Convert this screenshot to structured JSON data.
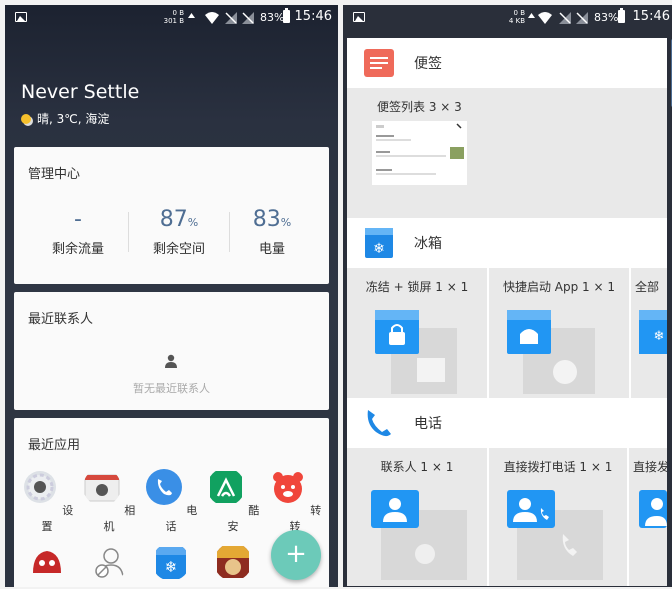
{
  "left": {
    "status": {
      "speed_top": "0 B",
      "speed_bottom": "301 B",
      "battery": "83%",
      "time": "15:46"
    },
    "title": "Never Settle",
    "weather": "晴, 3℃, 海淀",
    "manage": {
      "title": "管理中心",
      "items": [
        {
          "value": "-",
          "unit": "",
          "label": "剩余流量"
        },
        {
          "value": "87",
          "unit": "%",
          "label": "剩余空间"
        },
        {
          "value": "83",
          "unit": "%",
          "label": "电量"
        }
      ]
    },
    "contacts": {
      "title": "最近联系人",
      "empty": "暂无最近联系人"
    },
    "recent": {
      "title": "最近应用",
      "apps": [
        {
          "label": "设置"
        },
        {
          "label": "相机"
        },
        {
          "label": "电话"
        },
        {
          "label": "酷安"
        },
        {
          "label": "转转"
        }
      ]
    },
    "fab": "+"
  },
  "right": {
    "status": {
      "speed_top": "0 B",
      "speed_bottom": "4 KB",
      "battery": "83%",
      "time": "15:46"
    },
    "sections": [
      {
        "title": "便签",
        "widgets": [
          {
            "label": "便签列表 3 × 3"
          }
        ]
      },
      {
        "title": "冰箱",
        "widgets": [
          {
            "label": "冻结 + 锁屏 1 × 1"
          },
          {
            "label": "快捷启动 App 1 × 1"
          },
          {
            "label": "全部"
          }
        ]
      },
      {
        "title": "电话",
        "widgets": [
          {
            "label": "联系人 1 × 1"
          },
          {
            "label": "直接拨打电话 1 × 1"
          },
          {
            "label": "直接发"
          }
        ]
      }
    ]
  },
  "colors": {
    "accent": "#4f6e93",
    "fab": "#6ccab9",
    "blue": "#2196f3"
  }
}
